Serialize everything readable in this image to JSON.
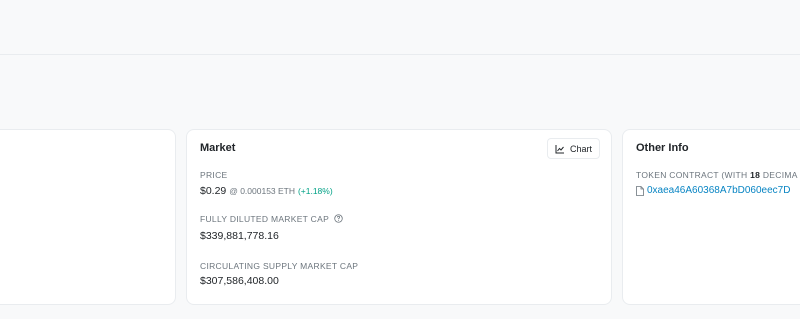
{
  "market": {
    "title": "Market",
    "chart_button": "Chart",
    "price_label": "PRICE",
    "price_value": "$0.29",
    "price_eth": "@ 0.000153 ETH",
    "price_change": "(+1.18%)",
    "fdmc_label": "FULLY DILUTED MARKET CAP",
    "fdmc_value": "$339,881,778.16",
    "csmc_label": "CIRCULATING SUPPLY MARKET CAP",
    "csmc_value": "$307,586,408.00"
  },
  "other_info": {
    "title": "Other Info",
    "token_contract_prefix": "TOKEN CONTRACT (WITH ",
    "decimals": "18",
    "token_contract_suffix": " DECIMA",
    "contract_address": "0xaea46A60368A7bD060eec7D"
  },
  "colors": {
    "link": "#0784c3",
    "positive": "#00a186",
    "muted": "#6c757d"
  }
}
